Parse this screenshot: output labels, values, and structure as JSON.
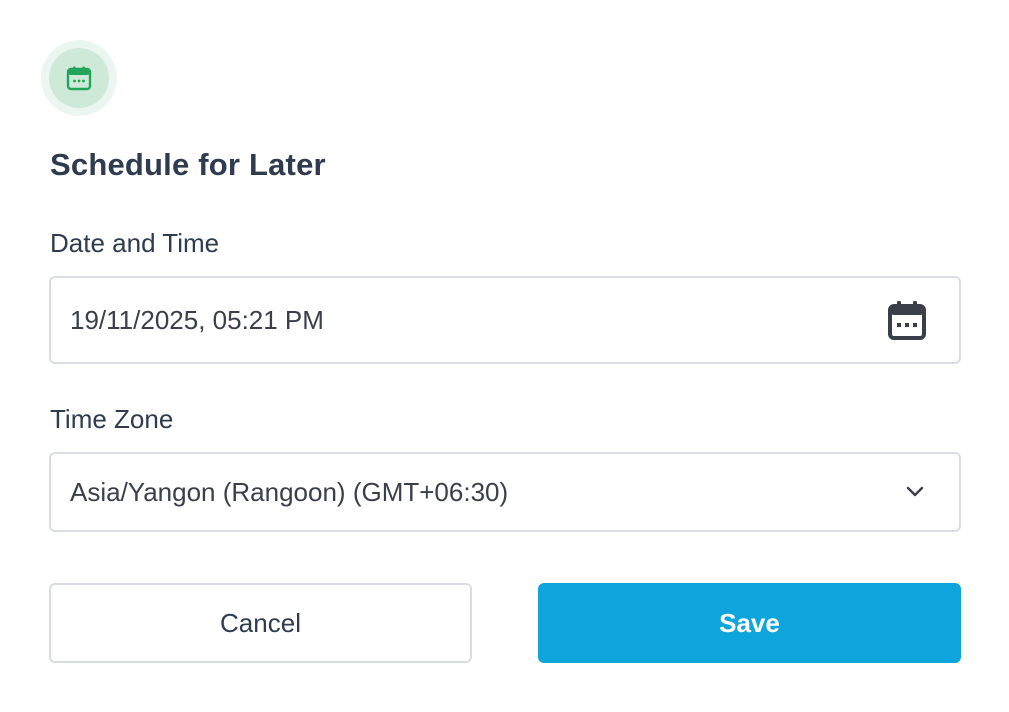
{
  "dialog": {
    "title": "Schedule for Later",
    "header_icon": "calendar-icon",
    "accent_color": "#22a55a"
  },
  "date_time": {
    "label": "Date and Time",
    "value": "19/11/2025, 05:21 PM",
    "icon": "calendar-icon"
  },
  "time_zone": {
    "label": "Time Zone",
    "selected": "Asia/Yangon (Rangoon) (GMT+06:30)",
    "icon": "chevron-down-icon"
  },
  "actions": {
    "cancel_label": "Cancel",
    "save_label": "Save",
    "save_color": "#0ea5dc"
  }
}
